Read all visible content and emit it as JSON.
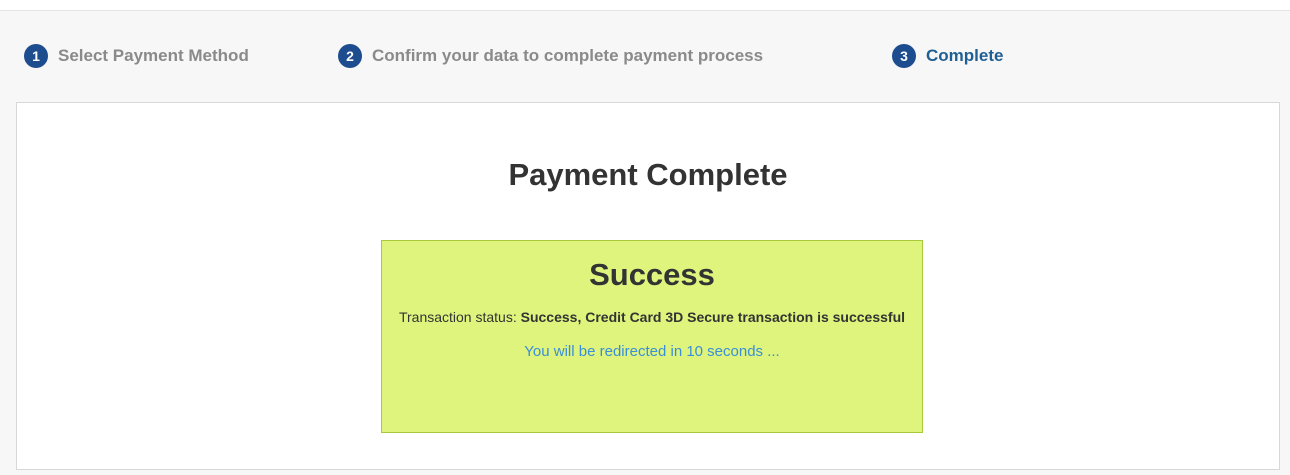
{
  "steps": [
    {
      "number": "1",
      "label": "Select Payment Method",
      "active": false
    },
    {
      "number": "2",
      "label": "Confirm your data to complete payment process",
      "active": false
    },
    {
      "number": "3",
      "label": "Complete",
      "active": true
    }
  ],
  "colors": {
    "step_badge": "#1d4c8f",
    "step_inactive": "#8a8a8a",
    "step_active": "#1f5f94",
    "success_bg": "#dff47d",
    "success_border": "#a8c93c",
    "redirect_text": "#3a8ed8"
  },
  "main": {
    "title": "Payment Complete",
    "status_box": {
      "heading": "Success",
      "status_prefix": "Transaction status: ",
      "status_value": "Success, Credit Card 3D Secure transaction is successful",
      "redirect": "You will be redirected in 10 seconds ..."
    }
  }
}
